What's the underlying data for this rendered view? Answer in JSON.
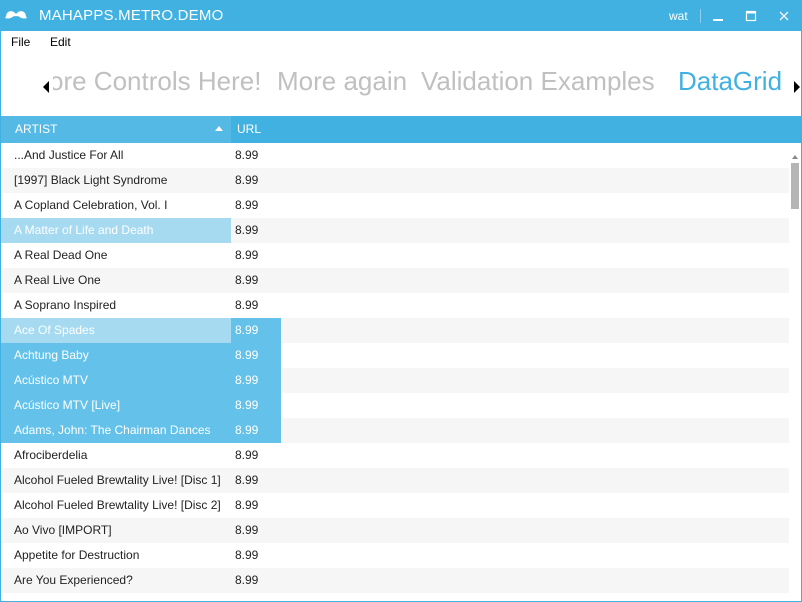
{
  "window": {
    "title": "MAHAPPS.METRO.DEMO",
    "user": "wat",
    "accent_color": "#41b1e1"
  },
  "titlebar_buttons": [
    {
      "name": "minimize",
      "icon": "minimize-icon"
    },
    {
      "name": "maximize",
      "icon": "maximize-icon"
    },
    {
      "name": "close",
      "icon": "close-icon"
    }
  ],
  "menu": {
    "items": [
      "File",
      "Edit"
    ]
  },
  "tabs": {
    "items": [
      {
        "label": "ore Controls Here!",
        "selected": false
      },
      {
        "label": "More again",
        "selected": false
      },
      {
        "label": "Validation Examples",
        "selected": false
      },
      {
        "label": "DataGrid",
        "selected": true
      }
    ],
    "prev_icon": "chevron-left-icon",
    "next_icon": "chevron-right-icon"
  },
  "grid": {
    "columns": [
      "ARTIST",
      "URL"
    ],
    "sort": {
      "column": "ARTIST",
      "direction": "ascending",
      "icon": "sort-ascending-icon"
    },
    "rows": [
      {
        "artist": "...And Justice For All",
        "url": "8.99"
      },
      {
        "artist": "[1997] Black Light Syndrome",
        "url": "8.99"
      },
      {
        "artist": "A Copland Celebration, Vol. I",
        "url": "8.99"
      },
      {
        "artist": "A Matter of Life and Death",
        "url": "8.99",
        "state": "focus"
      },
      {
        "artist": "A Real Dead One",
        "url": "8.99"
      },
      {
        "artist": "A Real Live One",
        "url": "8.99"
      },
      {
        "artist": "A Soprano Inspired",
        "url": "8.99"
      },
      {
        "artist": "Ace Of Spades",
        "url": "8.99",
        "state": "selected-first"
      },
      {
        "artist": "Achtung Baby",
        "url": "8.99",
        "state": "selected"
      },
      {
        "artist": "Acústico MTV",
        "url": "8.99",
        "state": "selected"
      },
      {
        "artist": "Acústico MTV [Live]",
        "url": "8.99",
        "state": "selected"
      },
      {
        "artist": "Adams, John: The Chairman Dances",
        "url": "8.99",
        "state": "selected"
      },
      {
        "artist": "Afrociberdelia",
        "url": "8.99"
      },
      {
        "artist": "Alcohol Fueled Brewtality Live! [Disc 1]",
        "url": "8.99"
      },
      {
        "artist": "Alcohol Fueled Brewtality Live! [Disc 2]",
        "url": "8.99"
      },
      {
        "artist": "Ao Vivo [IMPORT]",
        "url": "8.99"
      },
      {
        "artist": "Appetite for Destruction",
        "url": "8.99"
      },
      {
        "artist": "Are You Experienced?",
        "url": "8.99"
      }
    ]
  },
  "colors": {
    "selection": "#64c2ea",
    "selection_light": "#a6daf1",
    "inactive_tab": "#c0c0c0"
  }
}
